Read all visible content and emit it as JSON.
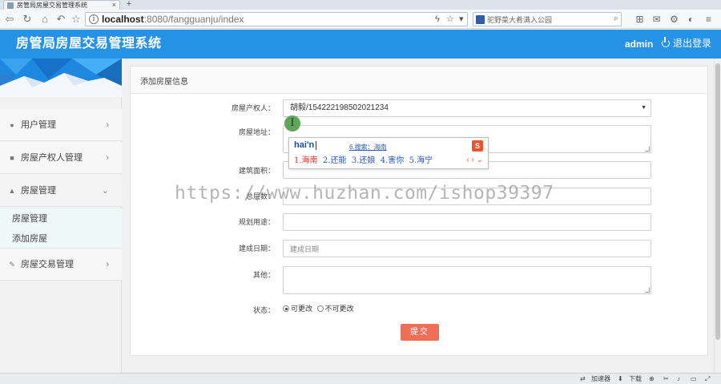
{
  "browser": {
    "tab_title": "房管局房屋交易管理系统",
    "tab_close": "×",
    "new_tab": "+",
    "url_host": "localhost",
    "url_rest": ":8080/fangguanju/index",
    "search_text": "驼野菜大肴满入公园",
    "status_accelerator": "加速器",
    "status_download": "下载"
  },
  "header": {
    "title": "房管局房屋交易管理系统",
    "user": "admin",
    "logout": "退出登录"
  },
  "sidebar": {
    "items": [
      {
        "label": "用户管理",
        "chev": "›"
      },
      {
        "label": "房屋产权人管理",
        "chev": "›"
      },
      {
        "label": "房屋管理",
        "chev": "⌄"
      },
      {
        "label": "房屋交易管理",
        "chev": "›"
      }
    ],
    "sub_items": [
      "房屋管理",
      "添加房屋"
    ]
  },
  "panel": {
    "title": "添加房屋信息"
  },
  "form": {
    "owner_label": "房屋产权人：",
    "owner_value": "胡毅/154222198502021234",
    "address_label": "房屋地址：",
    "area_label": "建筑面积：",
    "floors_label": "总层数：",
    "purpose_label": "规划用途：",
    "built_label": "建成日期：",
    "built_placeholder": "建成日期",
    "other_label": "其他：",
    "status_label": "状态：",
    "status_options": [
      "可更改",
      "不可更改"
    ],
    "submit": "提交"
  },
  "ime": {
    "pinyin": "hai'n",
    "search": "6.搜索：海南",
    "candidates": [
      "1.海南",
      "2.还能",
      "3.还娘",
      "4.害你",
      "5.海宁"
    ],
    "arrows": "‹ › ⌄"
  },
  "watermark": "https://www.huzhan.com/ishop39397",
  "colors": {
    "header_blue": "#2692e6",
    "submit_red": "#f06e58",
    "sidebar_sub_bg": "#eef8f7"
  }
}
